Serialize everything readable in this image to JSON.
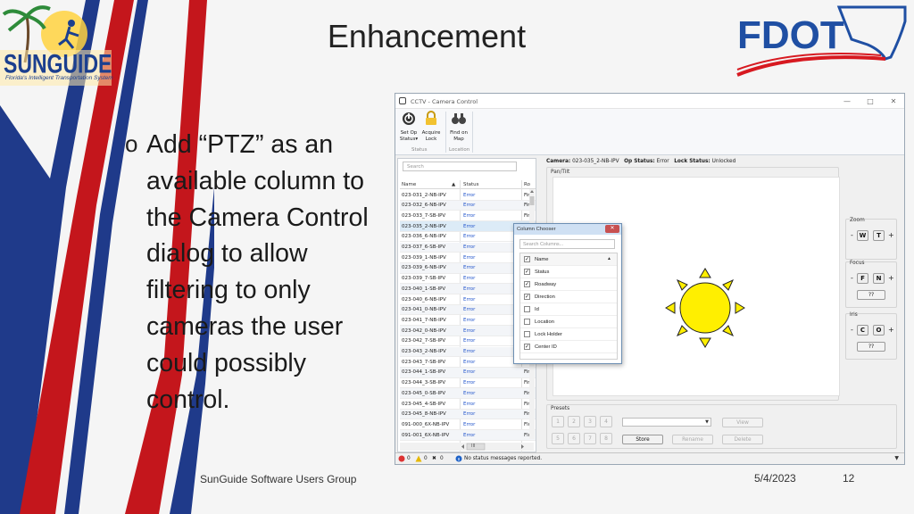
{
  "slide": {
    "title": "Enhancement",
    "bullet_marker": "o",
    "bullet_text": "Add “PTZ” as an available column to the Camera Control dialog to allow filtering to only cameras the user could possibly control.",
    "footer_left": "SunGuide Software Users Group",
    "footer_date": "5/4/2023",
    "slide_number": "12",
    "logo_left_name": "SUNGUIDE",
    "logo_left_tagline": "Florida's Intelligent Transportation System",
    "logo_right_name": "FDOT",
    "colors": {
      "stripe_red": "#c4161c",
      "stripe_blue": "#1f3a8a",
      "fdot_blue": "#1f4fa3",
      "fdot_red": "#d71920",
      "sun": "#ffef00"
    }
  },
  "window": {
    "title": "CCTV - Camera Control",
    "controls": [
      "—",
      "□",
      "✕"
    ],
    "ribbon": {
      "buttons": [
        {
          "label": "Set Op Status▾",
          "icon": "power-icon"
        },
        {
          "label": "Acquire Lock",
          "icon": "lock-icon"
        },
        {
          "label": "Find on Map",
          "icon": "binoculars-icon"
        }
      ],
      "groups": [
        "Status",
        "Location"
      ]
    },
    "search_placeholder": "Search",
    "grid": {
      "headers": [
        "Name",
        "Status",
        "Ro"
      ],
      "sort_marker": "▲",
      "rows": [
        {
          "name": "023-031_2-NB-IPV",
          "status": "Error",
          "role": "Fir"
        },
        {
          "name": "023-032_6-NB-IPV",
          "status": "Error",
          "role": "Fir"
        },
        {
          "name": "023-033_7-SB-IPV",
          "status": "Error",
          "role": "Fir"
        },
        {
          "name": "023-035_2-NB-IPV",
          "status": "Error",
          "role": "Fir"
        },
        {
          "name": "023-036_6-NB-IPV",
          "status": "Error",
          "role": "Fir"
        },
        {
          "name": "023-037_6-SB-IPV",
          "status": "Error",
          "role": "Fir"
        },
        {
          "name": "023-039_1-NB-IPV",
          "status": "Error",
          "role": "Fir"
        },
        {
          "name": "023-039_6-NB-IPV",
          "status": "Error",
          "role": "Fir"
        },
        {
          "name": "023-039_7-SB-IPV",
          "status": "Error",
          "role": "Fir"
        },
        {
          "name": "023-040_1-SB-IPV",
          "status": "Error",
          "role": "Fir"
        },
        {
          "name": "023-040_6-NB-IPV",
          "status": "Error",
          "role": "Fir"
        },
        {
          "name": "023-041_0-NB-IPV",
          "status": "Error",
          "role": "Fir"
        },
        {
          "name": "023-041_7-NB-IPV",
          "status": "Error",
          "role": "Fir"
        },
        {
          "name": "023-042_0-NB-IPV",
          "status": "Error",
          "role": "Fir"
        },
        {
          "name": "023-042_7-SB-IPV",
          "status": "Error",
          "role": "Fir"
        },
        {
          "name": "023-043_2-NB-IPV",
          "status": "Error",
          "role": "Fir"
        },
        {
          "name": "023-043_7-SB-IPV",
          "status": "Error",
          "role": "Fir"
        },
        {
          "name": "023-044_1-SB-IPV",
          "status": "Error",
          "role": "Fir"
        },
        {
          "name": "023-044_3-SB-IPV",
          "status": "Error",
          "role": "Fir"
        },
        {
          "name": "023-045_0-SB-IPV",
          "status": "Error",
          "role": "Fir"
        },
        {
          "name": "023-045_4-SB-IPV",
          "status": "Error",
          "role": "Fir"
        },
        {
          "name": "023-045_8-NB-IPV",
          "status": "Error",
          "role": "Fir"
        },
        {
          "name": "091-000_6X-NB-IPV",
          "status": "Error",
          "role": "Flc"
        },
        {
          "name": "091-001_6X-NB-IPV",
          "status": "Error",
          "role": "Flc"
        }
      ],
      "selected_index": 3,
      "hscroll_thumb": "III"
    },
    "camera_header": {
      "camera_label": "Camera:",
      "camera_value": "023-035_2-NB-IPV",
      "op_label": "Op Status:",
      "op_value": "Error",
      "lock_label": "Lock Status:",
      "lock_value": "Unlocked"
    },
    "pan_tilt_label": "Pan/Tilt",
    "zoom": {
      "label": "Zoom",
      "minus": "-",
      "btn1": "W",
      "btn2": "T",
      "plus": "+"
    },
    "focus": {
      "label": "Focus",
      "minus": "-",
      "btn1": "F",
      "btn2": "N",
      "plus": "+",
      "auto": "??"
    },
    "iris": {
      "label": "Iris",
      "minus": "-",
      "btn1": "C",
      "btn2": "O",
      "plus": "+",
      "auto": "??"
    },
    "presets": {
      "label": "Presets",
      "numbers_row1": [
        "1",
        "2",
        "3",
        "4"
      ],
      "numbers_row2": [
        "5",
        "6",
        "7",
        "8"
      ],
      "view": "View",
      "store": "Store",
      "rename": "Rename",
      "delete": "Delete"
    },
    "statusbar": {
      "errors": "0",
      "warnings": "0",
      "infos": "0",
      "message": "No status messages reported."
    }
  },
  "column_chooser": {
    "title": "Column Chooser",
    "search_placeholder": "Search Columns...",
    "columns": [
      {
        "label": "Name",
        "checked": true,
        "header": true
      },
      {
        "label": "Status",
        "checked": true
      },
      {
        "label": "Roadway",
        "checked": true
      },
      {
        "label": "Direction",
        "checked": true
      },
      {
        "label": "Id",
        "checked": false
      },
      {
        "label": "Location",
        "checked": false
      },
      {
        "label": "Lock Holder",
        "checked": false
      },
      {
        "label": "Center ID",
        "checked": true
      }
    ]
  }
}
